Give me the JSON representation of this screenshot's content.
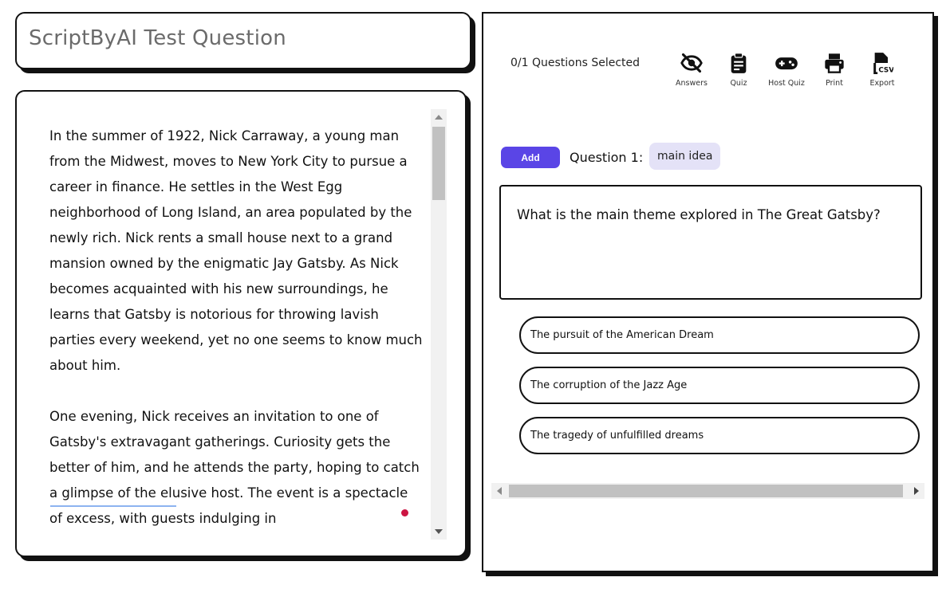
{
  "header": {
    "title": "ScriptByAI Test Question"
  },
  "passage": {
    "paragraphs": [
      "In the summer of 1922, Nick Carraway, a young man from the Midwest, moves to New York City to pursue a career in finance. He settles in the West Egg neighborhood of Long Island, an area populated by the newly rich. Nick rents a small house next to a grand mansion owned by the enigmatic Jay Gatsby. As Nick becomes acquainted with his new surroundings, he learns that Gatsby is notorious for throwing lavish parties every weekend, yet no one seems to know much about him.",
      "One evening, Nick receives an invitation to one of Gatsby's extravagant gatherings. Curiosity gets the better of him, and he attends the party, hoping to catch a glimpse of the elusive host. The event is a spectacle of excess, with guests indulging in"
    ]
  },
  "toolbar": {
    "selected_count": "0/1 Questions Selected",
    "buttons": [
      {
        "label": "Answers",
        "icon": "eye-off-icon"
      },
      {
        "label": "Quiz",
        "icon": "clipboard-icon"
      },
      {
        "label": "Host Quiz",
        "icon": "gamepad-icon"
      },
      {
        "label": "Print",
        "icon": "printer-icon"
      },
      {
        "label": "Export",
        "icon": "csv-file-icon"
      }
    ]
  },
  "question": {
    "add_label": "Add",
    "label": "Question 1:",
    "tag": "main idea",
    "text": "What is the main theme explored in The Great Gatsby?",
    "answers": [
      "The pursuit of the American Dream",
      "The corruption of the Jazz Age",
      "The tragedy of unfulfilled dreams"
    ]
  },
  "colors": {
    "accent": "#5a45e6",
    "tag_bg": "#e4e2f7",
    "dot": "#cc1543"
  }
}
